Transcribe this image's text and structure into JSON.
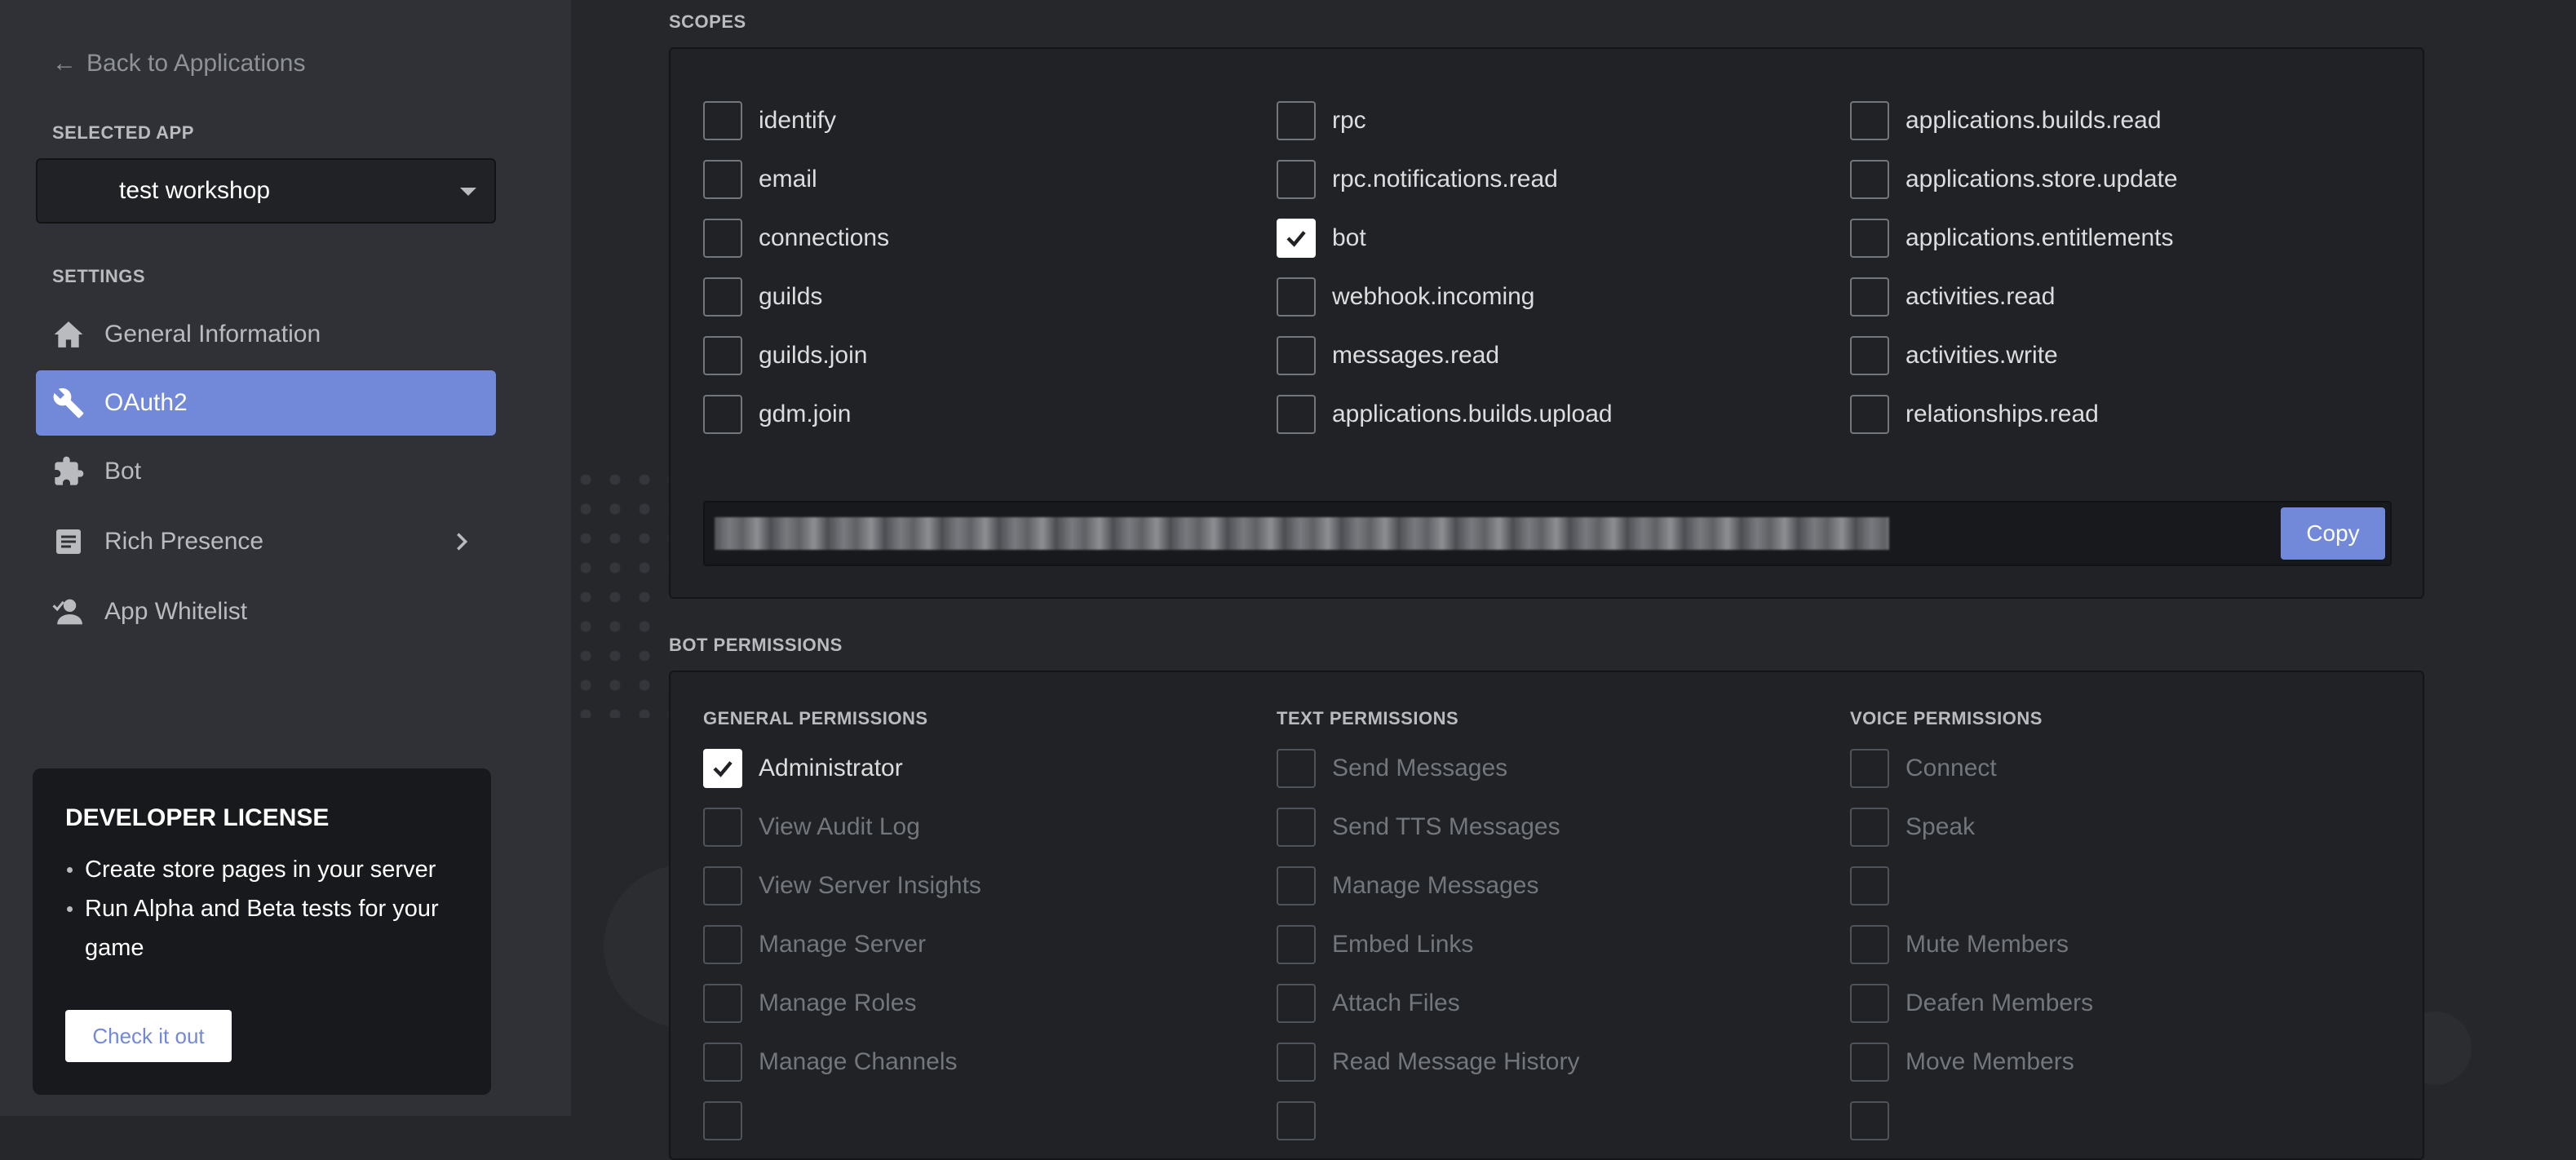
{
  "sidebar": {
    "back_label": "Back to Applications",
    "selected_app_label": "SELECTED APP",
    "selected_app": "test workshop",
    "settings_label": "SETTINGS",
    "items": [
      {
        "label": "General Information",
        "icon": "home-icon"
      },
      {
        "label": "OAuth2",
        "icon": "wrench-icon",
        "active": true
      },
      {
        "label": "Bot",
        "icon": "puzzle-icon"
      },
      {
        "label": "Rich Presence",
        "icon": "document-icon"
      },
      {
        "label": "App Whitelist",
        "icon": "user-icon"
      }
    ],
    "license": {
      "title": "DEVELOPER LICENSE",
      "bullets": [
        "Create store pages in your server",
        "Run Alpha and Beta tests for your game"
      ],
      "cta": "Check it out"
    }
  },
  "scopes": {
    "label": "SCOPES",
    "items": [
      {
        "label": "identify",
        "checked": false
      },
      {
        "label": "email",
        "checked": false
      },
      {
        "label": "connections",
        "checked": false
      },
      {
        "label": "guilds",
        "checked": false
      },
      {
        "label": "guilds.join",
        "checked": false
      },
      {
        "label": "gdm.join",
        "checked": false
      },
      {
        "label": "rpc",
        "checked": false
      },
      {
        "label": "rpc.notifications.read",
        "checked": false
      },
      {
        "label": "bot",
        "checked": true
      },
      {
        "label": "webhook.incoming",
        "checked": false
      },
      {
        "label": "messages.read",
        "checked": false
      },
      {
        "label": "applications.builds.upload",
        "checked": false
      },
      {
        "label": "applications.builds.read",
        "checked": false
      },
      {
        "label": "applications.store.update",
        "checked": false
      },
      {
        "label": "applications.entitlements",
        "checked": false
      },
      {
        "label": "activities.read",
        "checked": false
      },
      {
        "label": "activities.write",
        "checked": false
      },
      {
        "label": "relationships.read",
        "checked": false
      }
    ],
    "copy_label": "Copy"
  },
  "bot_permissions": {
    "label": "BOT PERMISSIONS",
    "general": {
      "heading": "GENERAL PERMISSIONS",
      "items": [
        {
          "label": "Administrator",
          "checked": true
        },
        {
          "label": "View Audit Log"
        },
        {
          "label": "View Server Insights"
        },
        {
          "label": "Manage Server"
        },
        {
          "label": "Manage Roles"
        },
        {
          "label": "Manage Channels"
        }
      ]
    },
    "text": {
      "heading": "TEXT PERMISSIONS",
      "items": [
        {
          "label": "Send Messages"
        },
        {
          "label": "Send TTS Messages"
        },
        {
          "label": "Manage Messages"
        },
        {
          "label": "Embed Links"
        },
        {
          "label": "Attach Files"
        },
        {
          "label": "Read Message History"
        }
      ]
    },
    "voice": {
      "heading": "VOICE PERMISSIONS",
      "items": [
        {
          "label": "Connect"
        },
        {
          "label": "Speak"
        },
        {
          "label": ""
        },
        {
          "label": "Mute Members"
        },
        {
          "label": "Deafen Members"
        },
        {
          "label": "Move Members"
        }
      ]
    }
  }
}
